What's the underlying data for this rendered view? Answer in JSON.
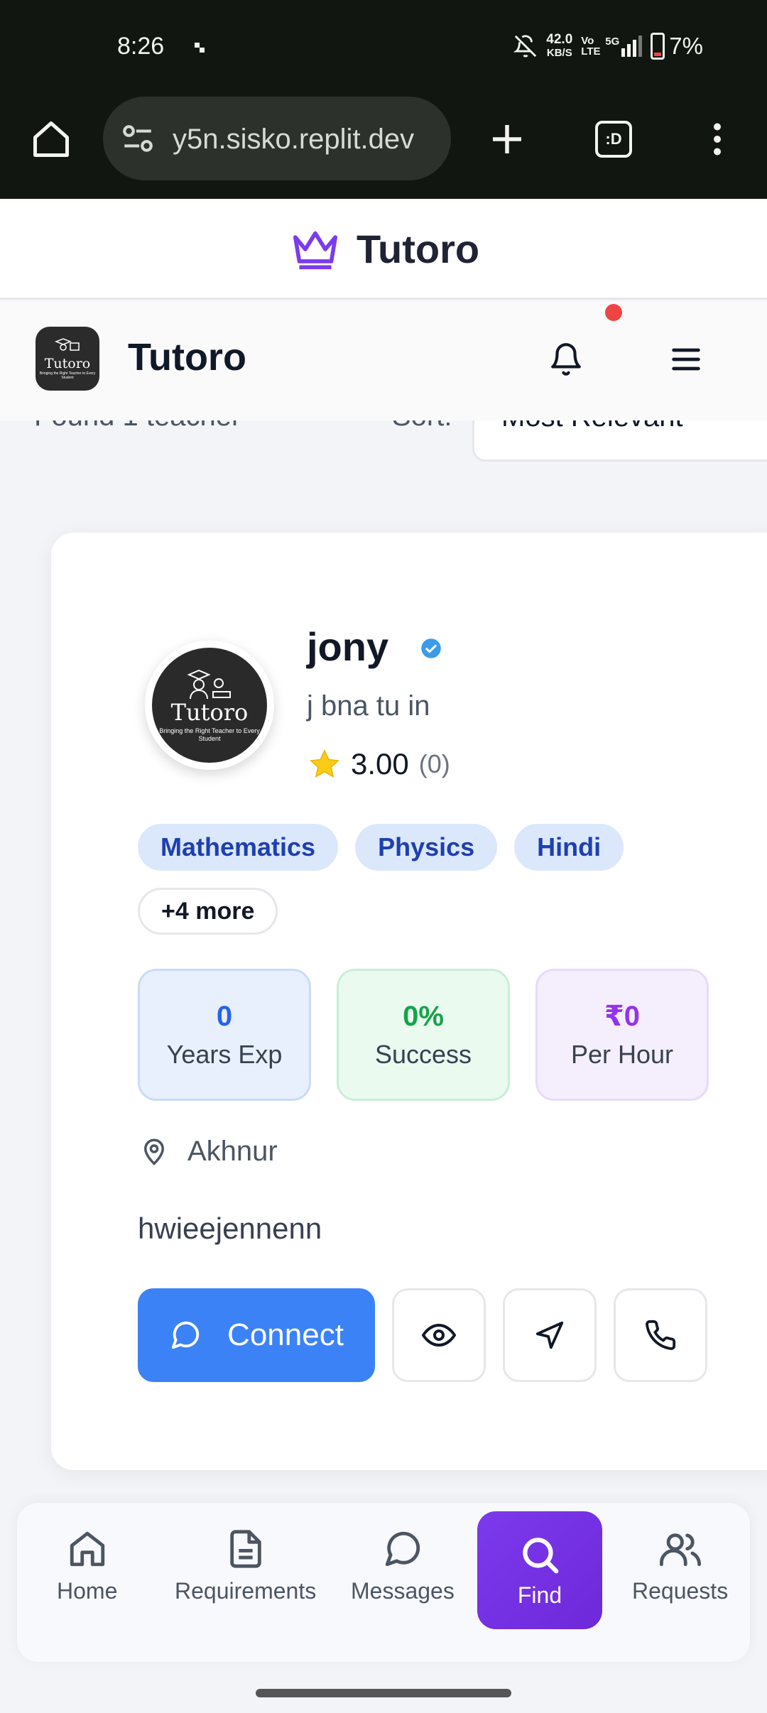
{
  "status_bar": {
    "time": "8:26",
    "net_speed_value": "42.0",
    "net_speed_unit": "KB/S",
    "volte": "Vo LTE",
    "network": "5G",
    "battery": "7%"
  },
  "browser": {
    "url": "y5n.sisko.replit.dev",
    "tab_switcher_label": ":D"
  },
  "site_header": {
    "brand": "Tutoro"
  },
  "app_header": {
    "title": "Tutoro",
    "logo_text": "Tutoro",
    "logo_tagline": "Bringing the Right Teacher to Every Student"
  },
  "results": {
    "found_text": "Found 1 teacher",
    "sort_label": "Sort:",
    "sort_value": "Most Relevant"
  },
  "teacher": {
    "name": "jony",
    "subtitle": "j bna tu in",
    "rating": "3.00",
    "rating_count": "(0)",
    "avatar_text": "Tutoro",
    "avatar_tagline": "Bringing the Right Teacher to Every Student",
    "subjects": [
      "Mathematics",
      "Physics",
      "Hindi"
    ],
    "more_subjects": "+4 more",
    "stats": [
      {
        "value": "0",
        "label": "Years Exp"
      },
      {
        "value": "0%",
        "label": "Success"
      },
      {
        "value": "₹0",
        "label": "Per Hour"
      }
    ],
    "location": "Akhnur",
    "description": "hwieejennenn",
    "connect_label": "Connect"
  },
  "bottom_nav": {
    "items": [
      {
        "label": "Home",
        "icon": "home-icon"
      },
      {
        "label": "Requirements",
        "icon": "document-icon"
      },
      {
        "label": "Messages",
        "icon": "chat-icon"
      },
      {
        "label": "Find",
        "icon": "search-icon"
      },
      {
        "label": "Requests",
        "icon": "users-icon"
      }
    ]
  },
  "colors": {
    "accent_purple": "#7c3aed",
    "connect_blue": "#3b82f6",
    "chip_bg": "#dbe7fb",
    "notification_dot": "#ef4444"
  }
}
